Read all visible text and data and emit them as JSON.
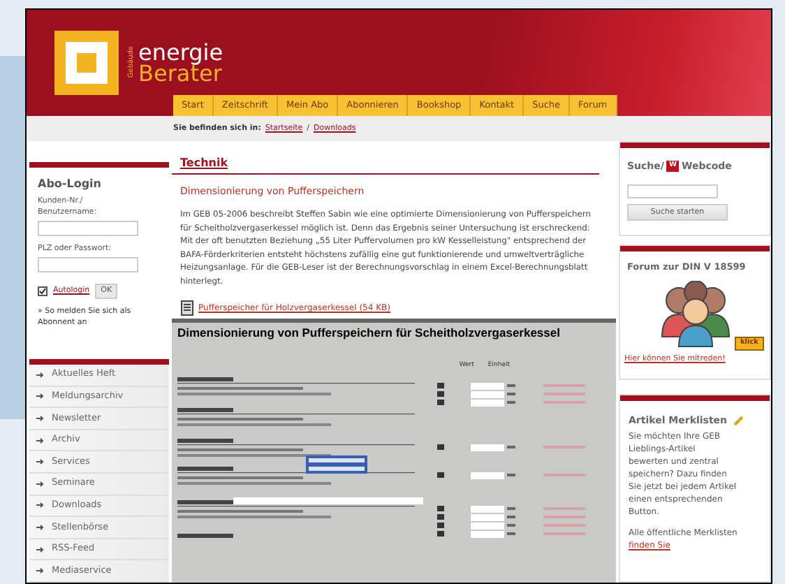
{
  "logo": {
    "prefix": "Gebäude",
    "line1": "energie",
    "line2": "Berater"
  },
  "nav": [
    "Start",
    "Zeitschrift",
    "Mein Abo",
    "Abonnieren",
    "Bookshop",
    "Kontakt",
    "Suche",
    "Forum"
  ],
  "breadcrumb": {
    "label": "Sie befinden sich in:",
    "links": [
      "Startseite",
      "Downloads"
    ],
    "separator": "/"
  },
  "login": {
    "title": "Abo-Login",
    "user_label": "Kunden-Nr./ Benutzername:",
    "password_label": "PLZ oder Passwort:",
    "remember": {
      "label": "Autologin",
      "checked": true
    },
    "submit": "OK",
    "hint": "» So melden Sie sich als Abonnent an"
  },
  "sidebar_links": [
    "Aktuelles Heft",
    "Meldungsarchiv",
    "Newsletter",
    "Archiv",
    "Services",
    "Seminare",
    "Downloads",
    "Stellenbörse",
    "RSS-Feed",
    "Mediaservice"
  ],
  "article": {
    "section": "Technik",
    "title": "Dimensionierung von Pufferspeichern",
    "body": "Im GEB 05-2006 beschreibt Steffen Sabin wie eine optimierte Dimensionierung von Pufferspeichern für Scheitholzvergaserkessel möglich ist. Denn das Ergebnis seiner Untersuchung ist erschreckend: Mit der oft benutzten Beziehung „55 Liter Puffervolumen pro kW Kesselleistung\" entsprechend der BAFA-Förderkriterien entsteht höchstens zufällig eine gut funktionierende und umweltverträgliche Heizungsanlage. Für die GEB-Leser ist der Berechnungsvorschlag in einem Excel-Berechnungsblatt hinterlegt.",
    "download": "Pufferspeicher für Holzvergaserkessel (54 KB)"
  },
  "spreadsheet": {
    "title": "Dimensionierung von Pufferspeichern für Scheitholzvergaserkessel",
    "columns": [
      "Wert",
      "Einheit"
    ]
  },
  "search": {
    "title": "Suche/",
    "badge": "W",
    "title_after": "Webcode",
    "button": "Suche starten"
  },
  "forum": {
    "title": "Forum zur DIN V 18599",
    "badge": "klick",
    "link": "Hier können Sie mitreden!"
  },
  "merklisten": {
    "title": "Artikel Merklisten",
    "body": "Sie möchten Ihre GEB Lieblings-Artikel bewerten und zentral speichern? Dazu finden Sie jetzt bei jedem Artikel einen entsprechenden Button.",
    "body2": "Alle öffentliche Merklisten",
    "link": "finden Sie"
  }
}
